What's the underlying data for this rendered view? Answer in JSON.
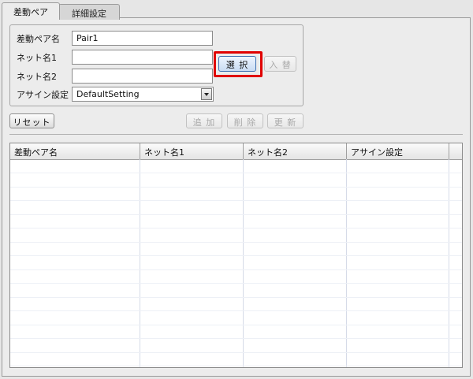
{
  "tabs": [
    "差動ペア",
    "詳細設定"
  ],
  "form": {
    "pair_name_label": "差動ペア名",
    "pair_name_value": "Pair1",
    "net1_label": "ネット名1",
    "net1_value": "",
    "net2_label": "ネット名2",
    "net2_value": "",
    "assign_label": "アサイン設定",
    "assign_value": "DefaultSetting"
  },
  "buttons": {
    "select": "選 択",
    "swap": "入 替",
    "reset": "リセット",
    "add": "追 加",
    "delete": "削 除",
    "update": "更 新"
  },
  "table": {
    "columns": [
      "差動ペア名",
      "ネット名1",
      "ネット名2",
      "アサイン設定"
    ],
    "rows": []
  },
  "colors": {
    "highlight": "#e00000",
    "focus_border": "#3c6fb0"
  }
}
